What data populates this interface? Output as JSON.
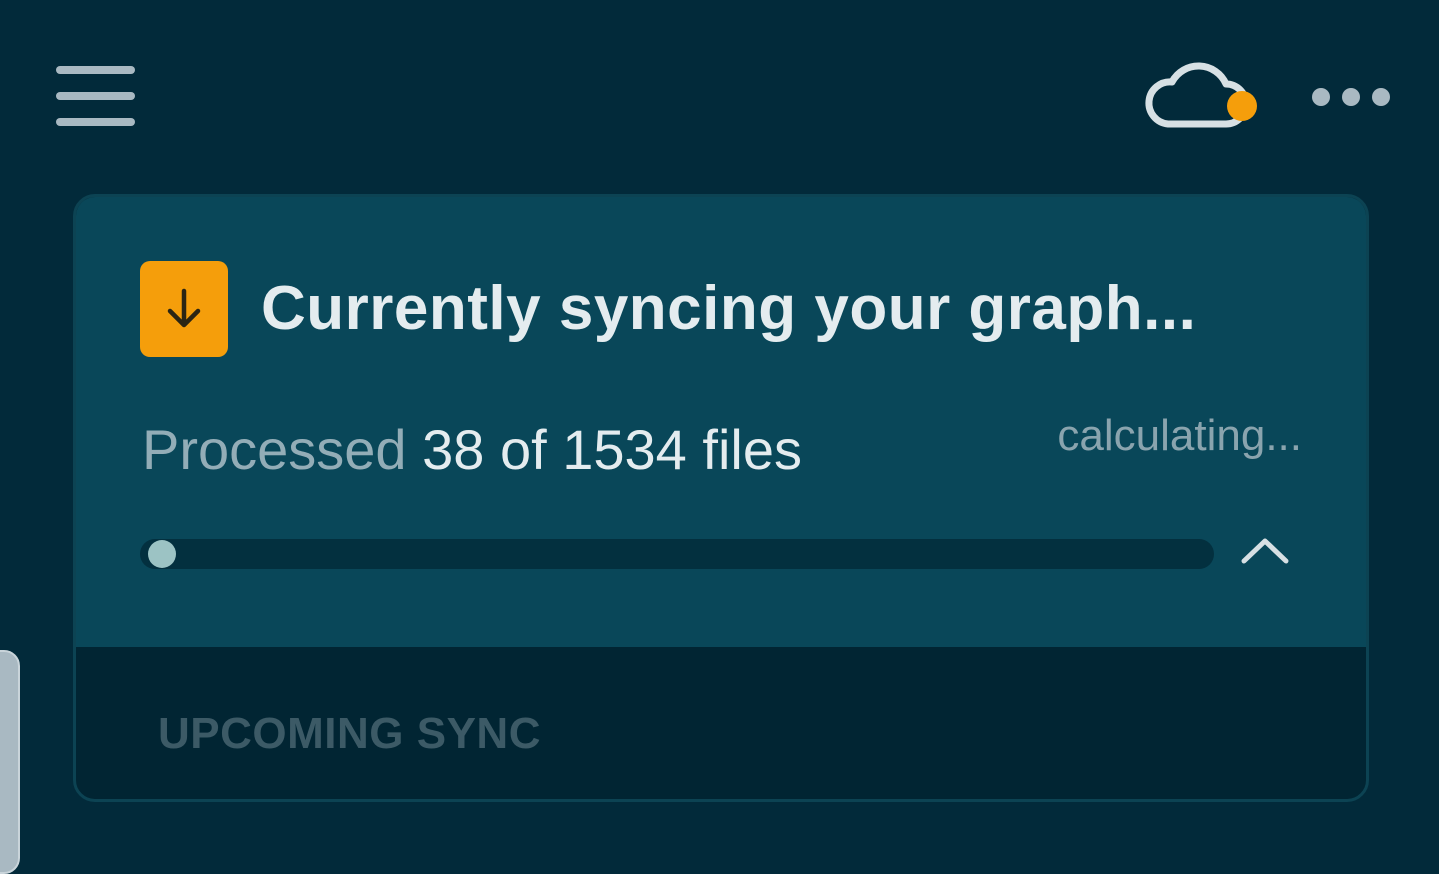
{
  "header": {
    "menu_icon": "hamburger-menu-icon",
    "sync_status_icon": "cloud-icon",
    "sync_status_dot_color": "#f59e0b",
    "more_icon": "more-horizontal-icon"
  },
  "sync_card": {
    "status_icon": "arrow-down-icon",
    "accent_color": "#f59e0b",
    "title": "Currently syncing your graph...",
    "progress_prefix": "Processed",
    "progress_count": "38 of 1534 files",
    "processed_files": 38,
    "total_files": 1534,
    "eta": "calculating...",
    "collapse_icon": "chevron-up-icon",
    "upcoming_label": "UPCOMING SYNC"
  }
}
